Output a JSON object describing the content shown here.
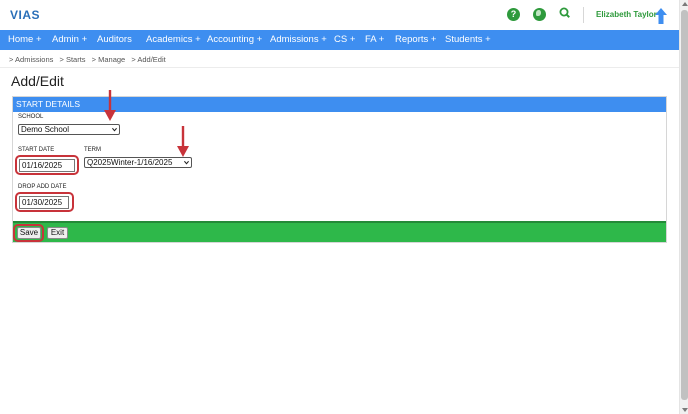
{
  "header": {
    "logo_text": "VIAS",
    "user_name": "Elizabeth Taylor",
    "icons": [
      "help-icon",
      "globe-icon",
      "search-icon",
      "user-arrow-icon"
    ]
  },
  "nav": {
    "items": [
      "Home +",
      "Admin +",
      "Auditors",
      "Academics +",
      "Accounting +",
      "Admissions +",
      "CS +",
      "FA +",
      "Reports +",
      "Students +"
    ]
  },
  "breadcrumb": [
    "> Admissions",
    "> Starts",
    "> Manage",
    "> Add/Edit"
  ],
  "page": {
    "title": "Add/Edit"
  },
  "form": {
    "section_title": "START DETAILS",
    "school_label": "SCHOOL",
    "school_value": "Demo School",
    "start_date_label": "START DATE",
    "start_date_value": "01/16/2025",
    "term_label": "TERM",
    "term_value": "Q2025Winter-1/16/2025",
    "drop_add_label": "DROP ADD DATE",
    "drop_add_value": "01/30/2025"
  },
  "actions": {
    "save_label": "Save",
    "exit_label": "Exit"
  },
  "colors": {
    "nav_blue": "#3e8ef0",
    "action_green": "#2eb84a",
    "annotation_red": "#c8333a",
    "brand_green": "#2e9a3c"
  }
}
